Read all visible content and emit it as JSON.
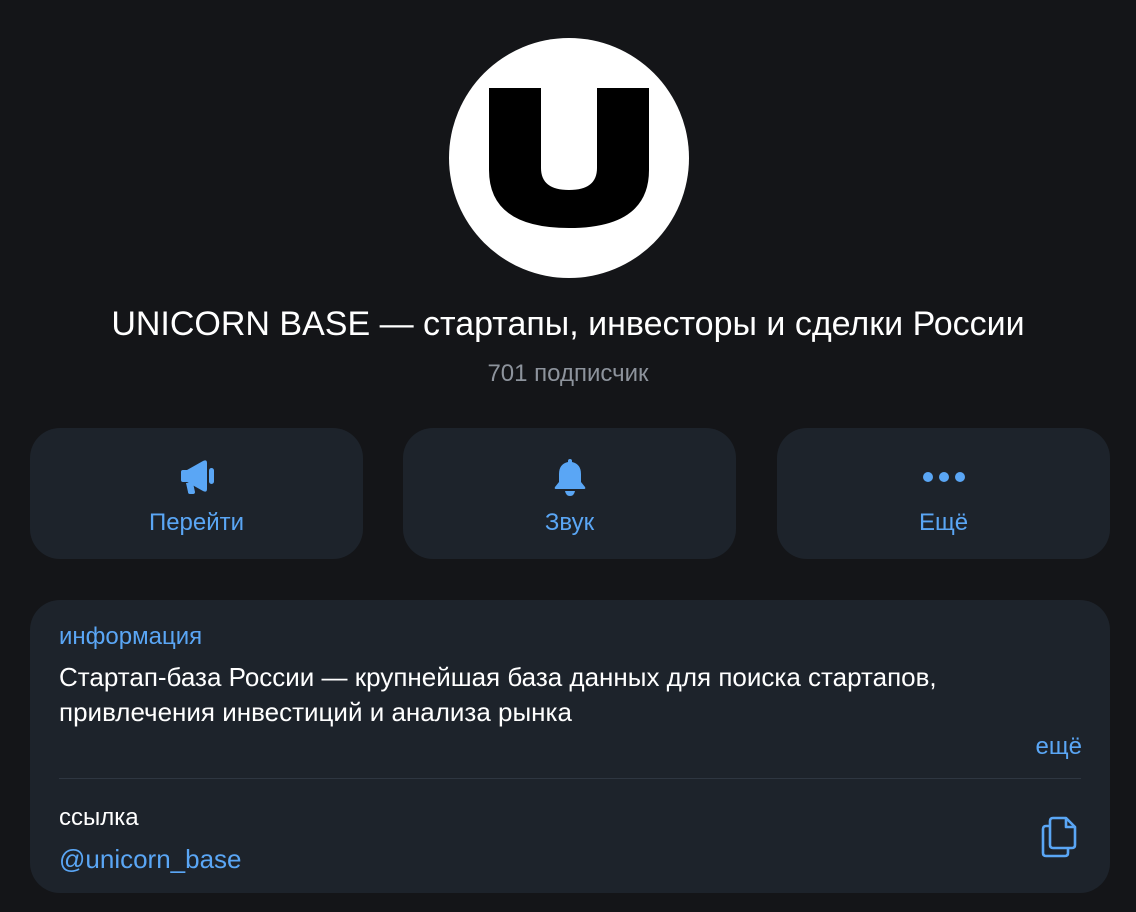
{
  "channel": {
    "title": "UNICORN BASE — стартапы, инвесторы и сделки России",
    "subscribers": "701 подписчик",
    "avatar_letter": "U"
  },
  "actions": [
    {
      "label": "Перейти",
      "icon": "megaphone-icon"
    },
    {
      "label": "Звук",
      "icon": "bell-icon"
    },
    {
      "label": "Ещё",
      "icon": "more-dots-icon"
    }
  ],
  "info": {
    "section_label": "информация",
    "description": "Стартап-база России — крупнейшая база данных для поиска стартапов, привлечения инвестиций и анализа рынка",
    "more_label": "ещё",
    "link_label": "ссылка",
    "link_value": "@unicorn_base",
    "copy_icon": "copy-icon"
  },
  "colors": {
    "background": "#141518",
    "card": "#1d232b",
    "accent": "#5aa6f5",
    "secondary_text": "#8d939c"
  }
}
